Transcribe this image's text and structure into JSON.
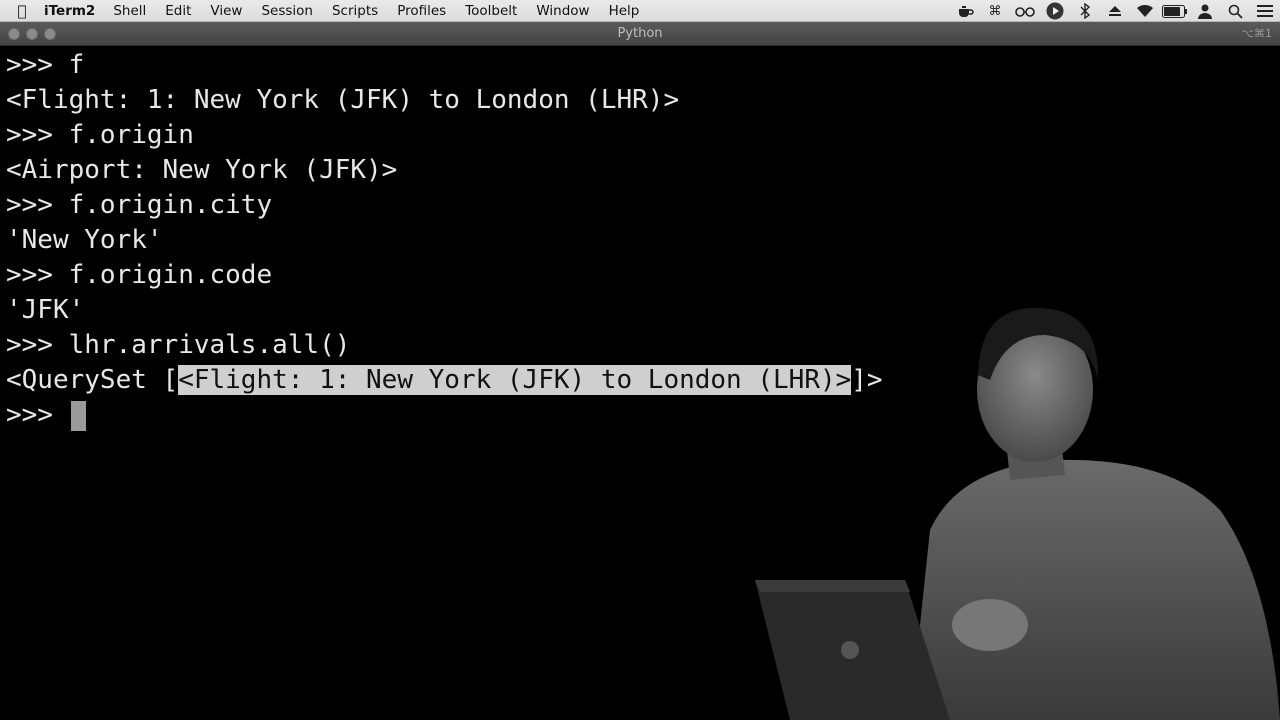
{
  "menubar": {
    "apple_icon": "apple-logo-icon",
    "app_name": "iTerm2",
    "items": [
      "Shell",
      "Edit",
      "View",
      "Session",
      "Scripts",
      "Profiles",
      "Toolbelt",
      "Window",
      "Help"
    ],
    "status_icons": [
      "teapot-icon",
      "command-icon",
      "glasses-icon",
      "play-circle-icon",
      "bluetooth-icon",
      "eject-icon",
      "wifi-icon",
      "battery-icon",
      "user-icon",
      "search-icon",
      "list-icon"
    ]
  },
  "window": {
    "title": "Python",
    "shortcut": "⌥⌘1"
  },
  "terminal": {
    "prompt": ">>>",
    "lines": [
      {
        "prompt": ">>> ",
        "text": "f"
      },
      {
        "prompt": "",
        "text": "<Flight: 1: New York (JFK) to London (LHR)>"
      },
      {
        "prompt": ">>> ",
        "text": "f.origin"
      },
      {
        "prompt": "",
        "text": "<Airport: New York (JFK)>"
      },
      {
        "prompt": ">>> ",
        "text": "f.origin.city"
      },
      {
        "prompt": "",
        "text": "'New York'"
      },
      {
        "prompt": ">>> ",
        "text": "f.origin.code"
      },
      {
        "prompt": "",
        "text": "'JFK'"
      },
      {
        "prompt": ">>> ",
        "text": "lhr.arrivals.all()"
      }
    ],
    "queryset_line": {
      "before": "<QuerySet [",
      "selected": "<Flight: 1: New York (JFK) to London (LHR)>",
      "after": "]>"
    },
    "active_prompt": ">>> "
  }
}
